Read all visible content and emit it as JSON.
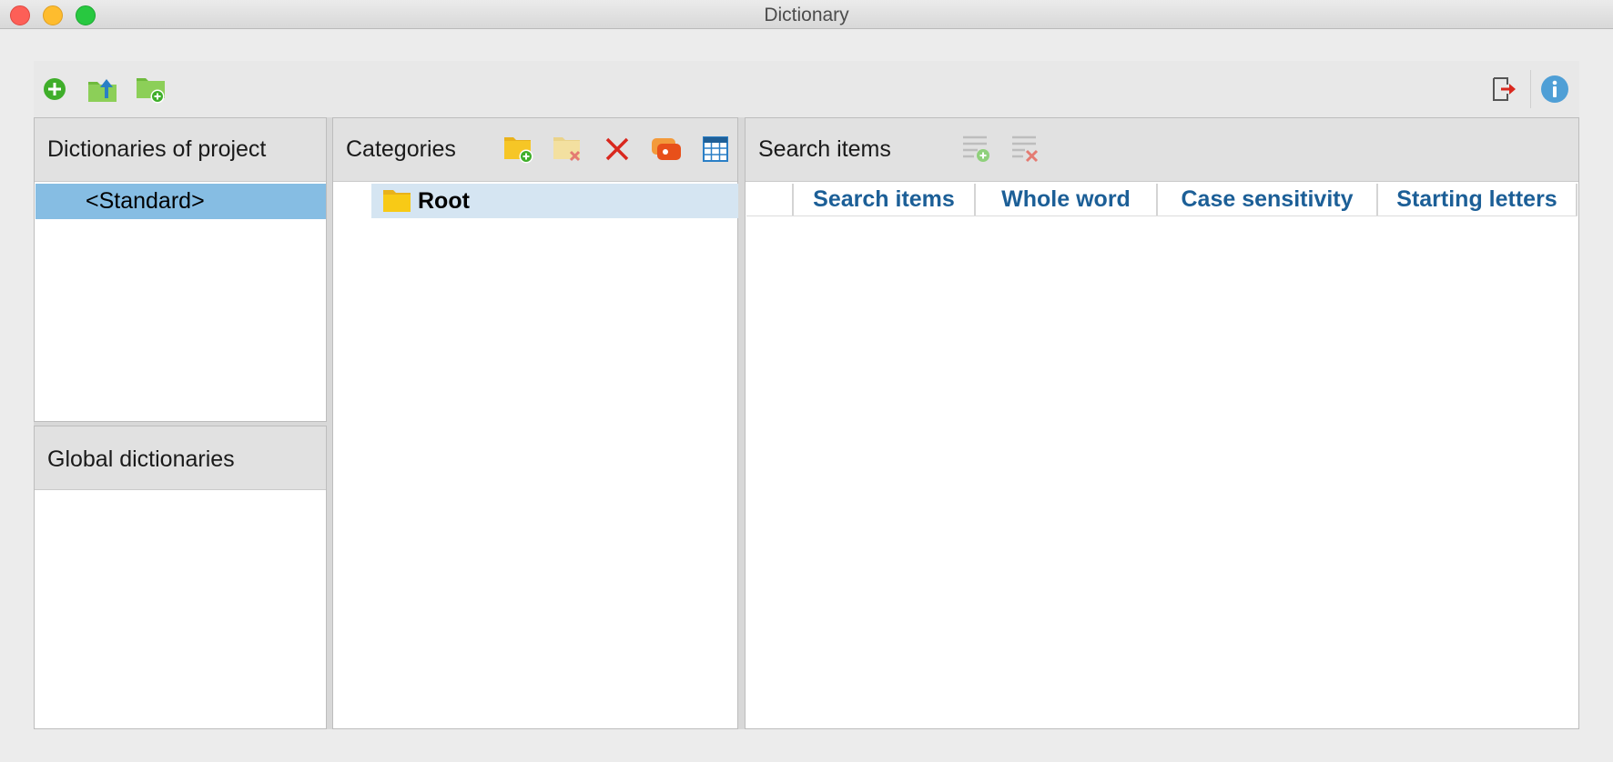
{
  "window": {
    "title": "Dictionary"
  },
  "toolbar": {
    "left_icons": [
      "add-circle-icon",
      "folder-export-icon",
      "folder-add-icon"
    ],
    "right_icons": [
      "exit-icon",
      "info-icon"
    ]
  },
  "dictionaries_panel": {
    "title": "Dictionaries of project",
    "items": [
      {
        "label": "<Standard>",
        "selected": true
      }
    ]
  },
  "global_panel": {
    "title": "Global dictionaries",
    "items": []
  },
  "categories_panel": {
    "title": "Categories",
    "icons": [
      "new-category-icon",
      "delete-category-folder-icon",
      "delete-icon",
      "import-icon",
      "table-icon"
    ],
    "tree": [
      {
        "label": "Root",
        "selected": true
      }
    ]
  },
  "search_panel": {
    "title": "Search items",
    "icons": [
      "add-search-item-icon",
      "delete-search-item-icon"
    ],
    "columns": [
      "Search items",
      "Whole word",
      "Case sensitivity",
      "Starting letters"
    ],
    "rows": []
  },
  "colors": {
    "selection_blue": "#86bde3",
    "tree_selection": "#d5e5f2",
    "column_header_text": "#1c5f97",
    "panel_header_bg": "#e1e1e1"
  }
}
